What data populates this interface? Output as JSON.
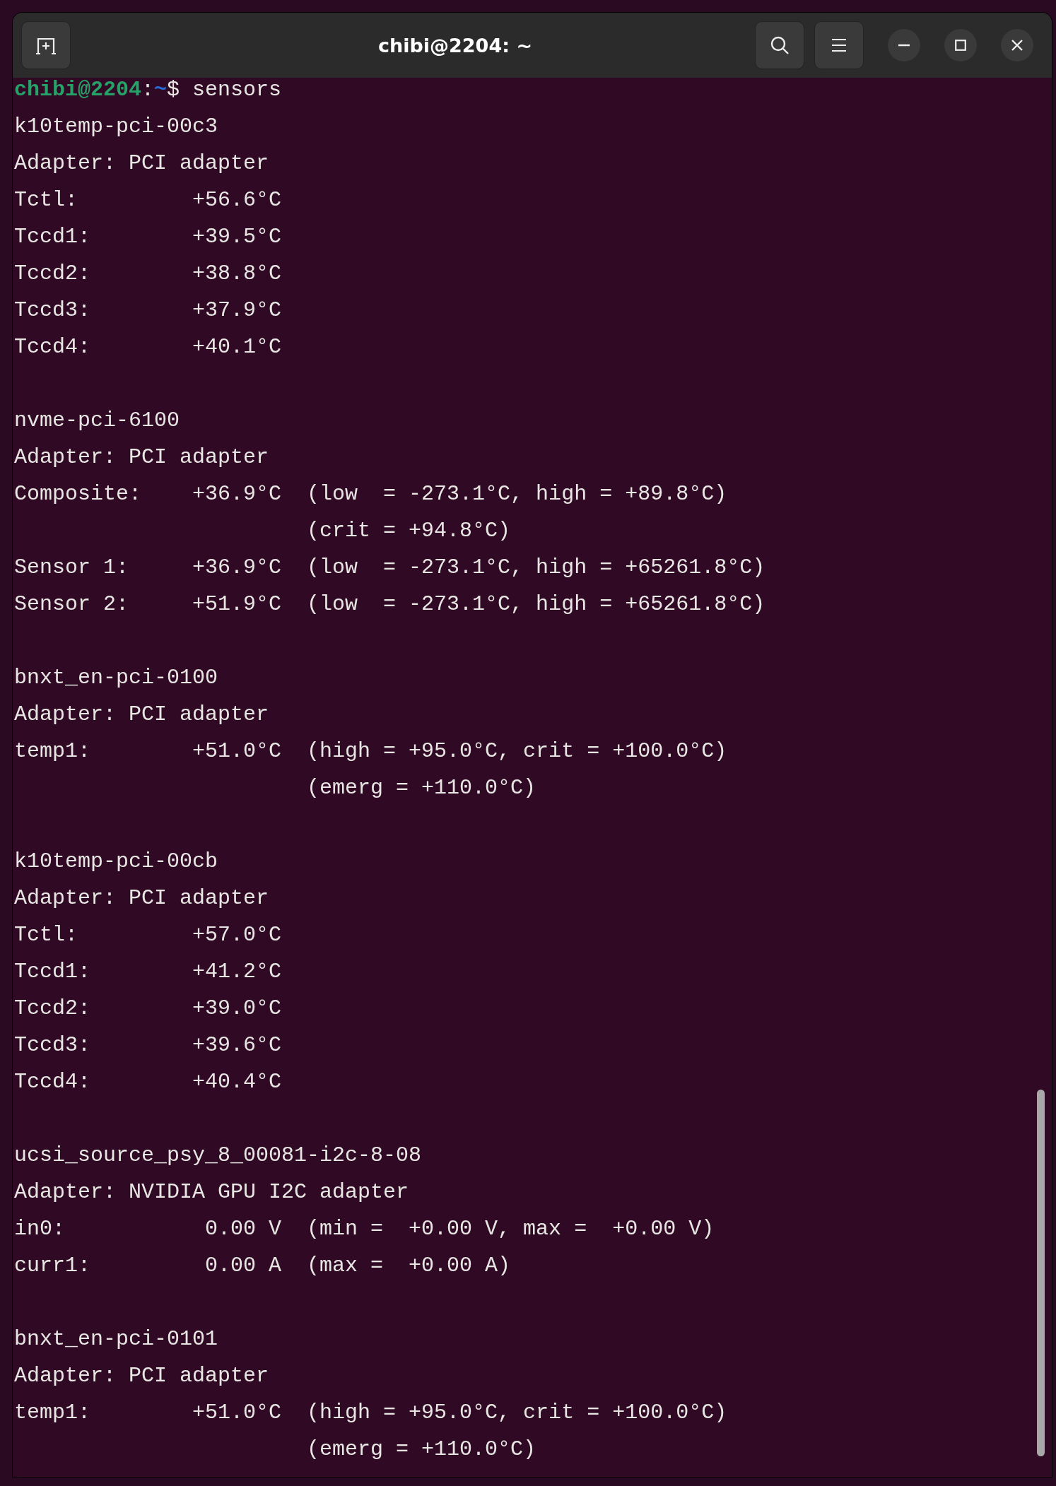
{
  "window": {
    "title": "chibi@2204: ~"
  },
  "prompt": {
    "user_host": "chibi@2204",
    "colon": ":",
    "path": "~",
    "symbol": "$",
    "command": "sensors"
  },
  "sections": [
    {
      "device": "k10temp-pci-00c3",
      "adapter": "Adapter: PCI adapter",
      "lines": [
        "Tctl:         +56.6°C",
        "Tccd1:        +39.5°C",
        "Tccd2:        +38.8°C",
        "Tccd3:        +37.9°C",
        "Tccd4:        +40.1°C"
      ]
    },
    {
      "device": "nvme-pci-6100",
      "adapter": "Adapter: PCI adapter",
      "lines": [
        "Composite:    +36.9°C  (low  = -273.1°C, high = +89.8°C)",
        "                       (crit = +94.8°C)",
        "Sensor 1:     +36.9°C  (low  = -273.1°C, high = +65261.8°C)",
        "Sensor 2:     +51.9°C  (low  = -273.1°C, high = +65261.8°C)"
      ]
    },
    {
      "device": "bnxt_en-pci-0100",
      "adapter": "Adapter: PCI adapter",
      "lines": [
        "temp1:        +51.0°C  (high = +95.0°C, crit = +100.0°C)",
        "                       (emerg = +110.0°C)"
      ]
    },
    {
      "device": "k10temp-pci-00cb",
      "adapter": "Adapter: PCI adapter",
      "lines": [
        "Tctl:         +57.0°C",
        "Tccd1:        +41.2°C",
        "Tccd2:        +39.0°C",
        "Tccd3:        +39.6°C",
        "Tccd4:        +40.4°C"
      ]
    },
    {
      "device": "ucsi_source_psy_8_00081-i2c-8-08",
      "adapter": "Adapter: NVIDIA GPU I2C adapter",
      "lines": [
        "in0:           0.00 V  (min =  +0.00 V, max =  +0.00 V)",
        "curr1:         0.00 A  (max =  +0.00 A)"
      ]
    },
    {
      "device": "bnxt_en-pci-0101",
      "adapter": "Adapter: PCI adapter",
      "lines": [
        "temp1:        +51.0°C  (high = +95.0°C, crit = +100.0°C)",
        "                       (emerg = +110.0°C)"
      ]
    }
  ]
}
